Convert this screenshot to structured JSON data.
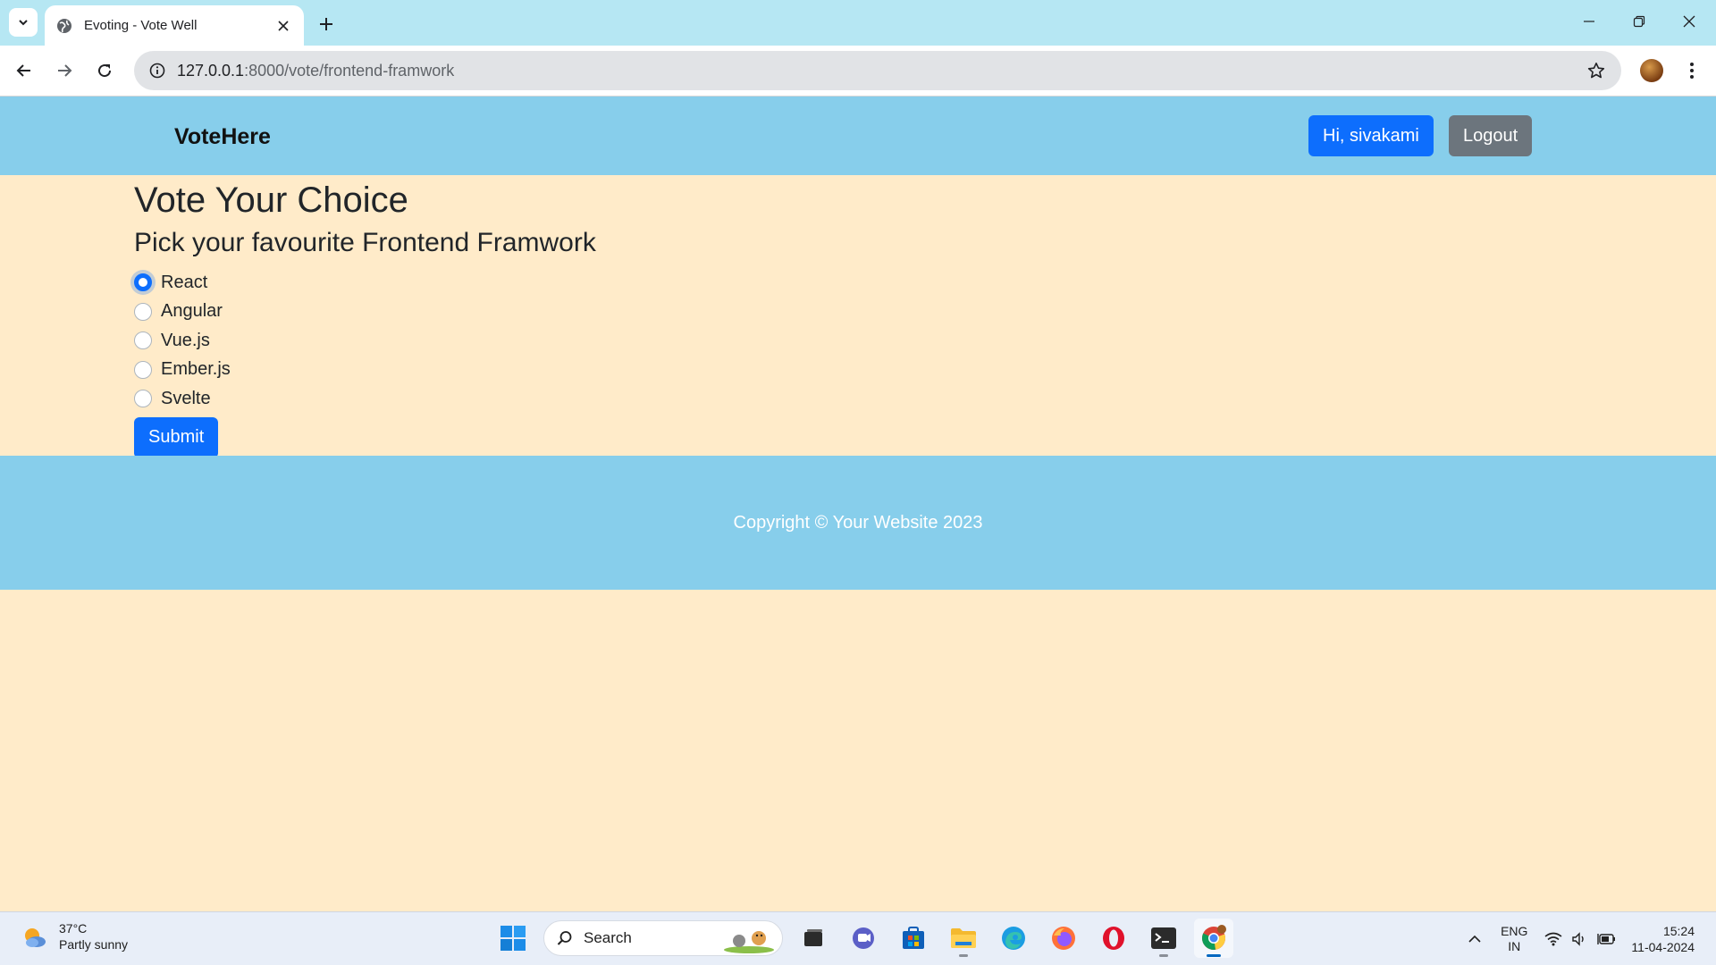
{
  "browser": {
    "tab_title": "Evoting - Vote Well",
    "url_host": "127.0.0.1",
    "url_path": ":8000/vote/frontend-framwork"
  },
  "navbar": {
    "brand": "VoteHere",
    "user_button": "Hi, sivakami",
    "logout_button": "Logout"
  },
  "poll": {
    "title": "Vote Your Choice",
    "question": "Pick your favourite Frontend Framwork",
    "options": [
      {
        "label": "React",
        "selected": true
      },
      {
        "label": "Angular",
        "selected": false
      },
      {
        "label": "Vue.js",
        "selected": false
      },
      {
        "label": "Ember.js",
        "selected": false
      },
      {
        "label": "Svelte",
        "selected": false
      }
    ],
    "submit_label": "Submit"
  },
  "footer": {
    "copyright": "Copyright © Your Website 2023"
  },
  "taskbar": {
    "weather_temp": "37°C",
    "weather_desc": "Partly sunny",
    "search_label": "Search",
    "lang_line1": "ENG",
    "lang_line2": "IN",
    "time": "15:24",
    "date": "11-04-2024"
  },
  "colors": {
    "page_bg": "#ffebc9",
    "nav_bg": "#87ceeb",
    "primary": "#0d6efd",
    "secondary": "#6c757d"
  }
}
